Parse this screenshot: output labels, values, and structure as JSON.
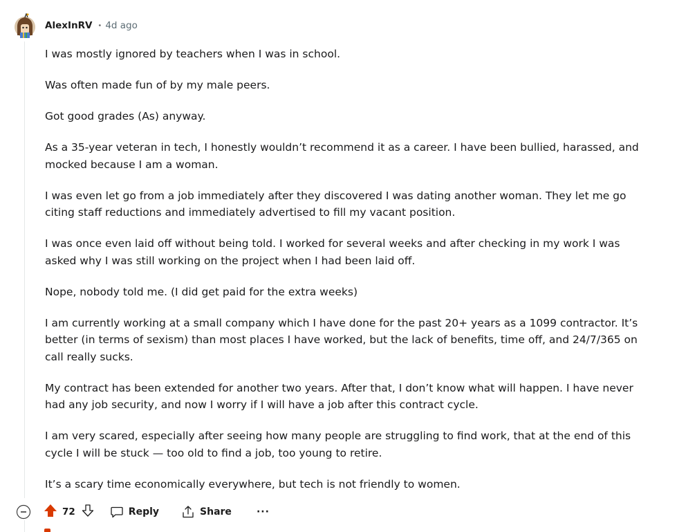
{
  "comment": {
    "author": "AlexInRV",
    "separator": "•",
    "time": "4d ago",
    "paragraphs": [
      "I was mostly ignored by teachers when I was in school.",
      "Was often made fun of by my male peers.",
      "Got good grades (As) anyway.",
      "As a 35-year veteran in tech, I honestly wouldn’t recommend it as a career. I have been bullied, harassed, and mocked because I am a woman.",
      "I was even let go from a job immediately after they discovered I was dating another woman. They let me go citing staff reductions and immediately advertised to fill my vacant position.",
      "I was once even laid off without being told. I worked for several weeks and after checking in my work I was asked why I was still working on the project when I had been laid off.",
      "Nope, nobody told me. (I did get paid for the extra weeks)",
      "I am currently working at a small company which I have done for the past 20+ years as a 1099 contractor. It’s better (in terms of sexism) than most places I have worked, but the lack of benefits, time off, and 24/7/365 on call really sucks.",
      "My contract has been extended for another two years. After that, I don’t know what will happen. I have never had any job security, and now I worry if I will have a job after this contract cycle.",
      "I am very scared, especially after seeing how many people are struggling to find work, that at the end of this cycle I will be stuck — too old to find a job, too young to retire.",
      "It’s a scary time economically everywhere, but tech is not friendly to women."
    ]
  },
  "actions": {
    "score": "72",
    "reply_label": "Reply",
    "share_label": "Share",
    "more_label": "···"
  },
  "colors": {
    "upvote": "#d93a00",
    "thread_line": "#e5e7e8",
    "meta_text": "#5c6c74"
  },
  "icons": {
    "collapse": "minus-circle-icon",
    "upvote": "upvote-arrow-icon",
    "downvote": "downvote-arrow-icon",
    "reply": "comment-bubble-icon",
    "share": "share-icon",
    "more": "ellipsis-icon"
  }
}
